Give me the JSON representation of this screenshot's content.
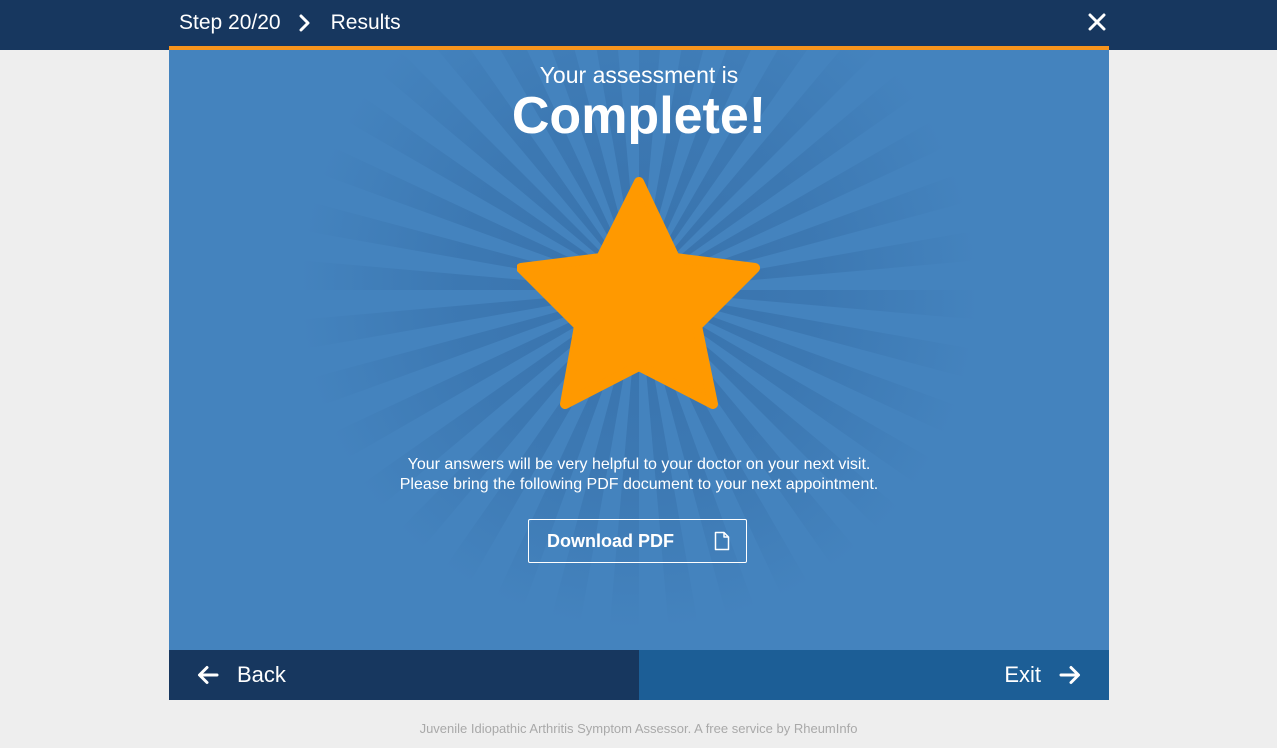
{
  "header": {
    "step": "Step 20/20",
    "section": "Results"
  },
  "panel": {
    "subtitle": "Your assessment is",
    "title": "Complete!",
    "message_line1": "Your answers will be very helpful to your doctor on your next visit.",
    "message_line2": "Please bring the following PDF document to your next appointment.",
    "download_label": "Download PDF"
  },
  "nav": {
    "back_label": "Back",
    "exit_label": "Exit"
  },
  "footer": {
    "text": "Juvenile Idiopathic Arthritis Symptom Assessor. A free service by RheumInfo"
  },
  "icons": {
    "step": "chevron-right-icon",
    "close": "close-icon",
    "award": "star-icon",
    "file": "document-icon",
    "back": "arrow-left-icon",
    "exit": "arrow-right-icon"
  },
  "colors": {
    "header": "#17375f",
    "accent": "#f7941d",
    "panel": "#4483be",
    "star": "#ff9900",
    "exit": "#1c5e96"
  }
}
